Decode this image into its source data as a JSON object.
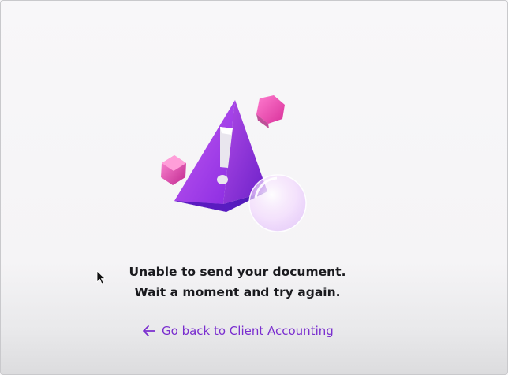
{
  "error": {
    "line1": "Unable to send your document.",
    "line2": "Wait a moment and try again."
  },
  "back_link": {
    "label": "Go back to Client Accounting",
    "icon": "arrow-left-icon"
  },
  "illustration": {
    "icon": "warning-triangle-icon"
  },
  "colors": {
    "link": "#7a2ecf",
    "text": "#1a1a1e",
    "background": "#f6f5f7",
    "accent_purple": "#8b2fd6",
    "accent_pink": "#e040a8"
  }
}
